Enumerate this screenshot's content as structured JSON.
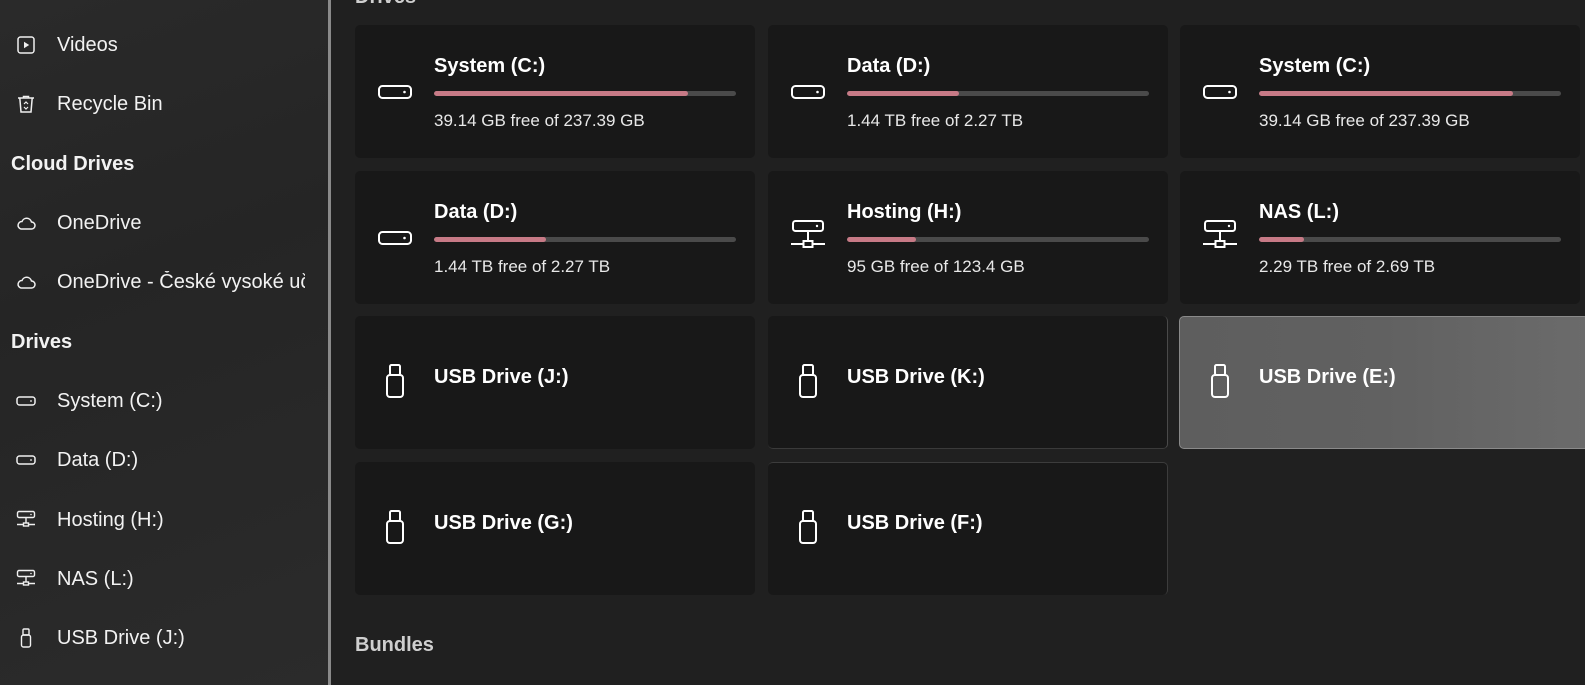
{
  "sidebar": {
    "items_top": [
      {
        "label": "Videos",
        "icon": "video-icon"
      },
      {
        "label": "Recycle Bin",
        "icon": "recycle-bin-icon"
      }
    ],
    "cloud_header": "Cloud Drives",
    "cloud_items": [
      {
        "label": "OneDrive",
        "icon": "cloud-icon"
      },
      {
        "label": "OneDrive - České vysoké uč",
        "icon": "cloud-icon"
      }
    ],
    "drives_header": "Drives",
    "drive_items": [
      {
        "label": "System (C:)",
        "icon": "drive-icon"
      },
      {
        "label": "Data (D:)",
        "icon": "drive-icon"
      },
      {
        "label": "Hosting (H:)",
        "icon": "network-drive-icon"
      },
      {
        "label": "NAS (L:)",
        "icon": "network-drive-icon"
      },
      {
        "label": "USB Drive (J:)",
        "icon": "usb-icon"
      }
    ]
  },
  "main": {
    "drives_title": "Drives",
    "bundles_title": "Bundles",
    "cards": [
      {
        "name": "System (C:)",
        "free": "39.14 GB free of 237.39 GB",
        "used_fraction": 0.84,
        "icon": "drive-icon"
      },
      {
        "name": "Data (D:)",
        "free": "1.44 TB free of 2.27 TB",
        "used_fraction": 0.37,
        "icon": "drive-icon"
      },
      {
        "name": "System (C:)",
        "free": "39.14 GB free of 237.39 GB",
        "used_fraction": 0.84,
        "icon": "drive-icon"
      },
      {
        "name": "Data (D:)",
        "free": "1.44 TB free of 2.27 TB",
        "used_fraction": 0.37,
        "icon": "drive-icon"
      },
      {
        "name": "Hosting (H:)",
        "free": "95 GB free of 123.4 GB",
        "used_fraction": 0.23,
        "icon": "network-drive-icon"
      },
      {
        "name": "NAS (L:)",
        "free": "2.29 TB free of 2.69 TB",
        "used_fraction": 0.15,
        "icon": "network-drive-icon"
      },
      {
        "name": "USB Drive (J:)",
        "icon": "usb-icon"
      },
      {
        "name": "USB Drive (K:)",
        "icon": "usb-icon"
      },
      {
        "name": "USB Drive (E:)",
        "icon": "usb-icon",
        "selected": true
      },
      {
        "name": "USB Drive (G:)",
        "icon": "usb-icon"
      },
      {
        "name": "USB Drive (F:)",
        "icon": "usb-icon"
      }
    ]
  },
  "colors": {
    "usage_bar": "#c77a86",
    "usage_track": "#4a4a4a",
    "card_bg": "#181818",
    "selected_card_bg": "#616161"
  }
}
